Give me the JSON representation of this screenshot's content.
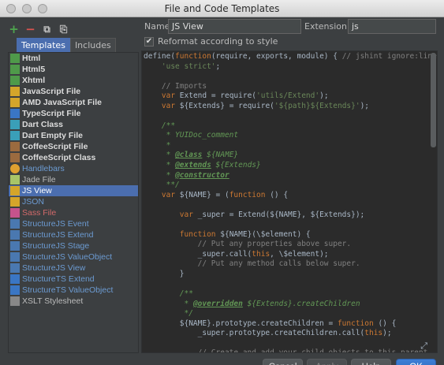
{
  "window": {
    "title": "File and Code Templates"
  },
  "toolbar": {
    "add": "+",
    "remove": "−",
    "copy": "⧉",
    "reset": "⎘"
  },
  "tabs": [
    {
      "label": "Templates",
      "active": true
    },
    {
      "label": "Includes",
      "active": false
    }
  ],
  "templates": [
    {
      "label": "Html",
      "icon": "html-file-icon",
      "style": "bold",
      "color": "c-html"
    },
    {
      "label": "Html5",
      "icon": "html-file-icon",
      "style": "bold",
      "color": "c-html"
    },
    {
      "label": "Xhtml",
      "icon": "html-file-icon",
      "style": "bold",
      "color": "c-html"
    },
    {
      "label": "JavaScript File",
      "icon": "javascript-file-icon",
      "style": "bold",
      "color": "c-js"
    },
    {
      "label": "AMD JavaScript File",
      "icon": "javascript-file-icon",
      "style": "bold",
      "color": "c-js"
    },
    {
      "label": "TypeScript File",
      "icon": "typescript-file-icon",
      "style": "bold",
      "color": "c-ts"
    },
    {
      "label": "Dart Class",
      "icon": "dart-file-icon",
      "style": "bold",
      "color": "c-dart"
    },
    {
      "label": "Dart Empty File",
      "icon": "dart-file-icon",
      "style": "bold",
      "color": "c-dart"
    },
    {
      "label": "CoffeeScript File",
      "icon": "coffeescript-file-icon",
      "style": "bold",
      "color": "c-coffee"
    },
    {
      "label": "CoffeeScript Class",
      "icon": "coffeescript-file-icon",
      "style": "bold",
      "color": "c-coffee"
    },
    {
      "label": "Handlebars",
      "icon": "handlebars-file-icon",
      "style": "blue",
      "color": "c-hbs"
    },
    {
      "label": "Jade File",
      "icon": "jade-file-icon",
      "style": "plain",
      "color": "c-jade"
    },
    {
      "label": "JS View",
      "icon": "javascript-file-icon",
      "style": "blue",
      "color": "c-js",
      "selected": true
    },
    {
      "label": "JSON",
      "icon": "json-file-icon",
      "style": "blue",
      "color": "c-js"
    },
    {
      "label": "Sass File",
      "icon": "sass-file-icon",
      "style": "red",
      "color": "c-sass"
    },
    {
      "label": "StructureJS Event",
      "icon": "javascript-file-icon",
      "style": "blue",
      "color": "c-sjs"
    },
    {
      "label": "StructureJS Extend",
      "icon": "javascript-file-icon",
      "style": "blue",
      "color": "c-sjs"
    },
    {
      "label": "StructureJS Stage",
      "icon": "javascript-file-icon",
      "style": "blue",
      "color": "c-sjs"
    },
    {
      "label": "StructureJS ValueObject",
      "icon": "javascript-file-icon",
      "style": "blue",
      "color": "c-sjs"
    },
    {
      "label": "StructureJS View",
      "icon": "javascript-file-icon",
      "style": "blue",
      "color": "c-sjs"
    },
    {
      "label": "StructureTS Extend",
      "icon": "typescript-file-icon",
      "style": "blue",
      "color": "c-ts"
    },
    {
      "label": "StructureTS ValueObject",
      "icon": "typescript-file-icon",
      "style": "blue",
      "color": "c-ts"
    },
    {
      "label": "XSLT Stylesheet",
      "icon": "xslt-file-icon",
      "style": "plain",
      "color": "c-xslt"
    }
  ],
  "form": {
    "name_label": "Name:",
    "name_value": "JS View",
    "extension_label": "Extension:",
    "extension_value": "js",
    "reformat_label": "Reformat according to style",
    "reformat_checked": true
  },
  "code_lines": [
    [
      [
        "",
        "define("
      ],
      [
        "kw",
        "function"
      ],
      [
        "",
        "(require, exports, module) { "
      ],
      [
        "cmt",
        "// jshint ignore:line"
      ]
    ],
    [
      [
        "",
        "    "
      ],
      [
        "str",
        "'use strict'"
      ],
      [
        "",
        ";"
      ]
    ],
    [
      [
        "",
        ""
      ]
    ],
    [
      [
        "",
        "    "
      ],
      [
        "cmt",
        "// Imports"
      ]
    ],
    [
      [
        "",
        "    "
      ],
      [
        "kw",
        "var"
      ],
      [
        "",
        " Extend = require("
      ],
      [
        "str",
        "'utils/Extend'"
      ],
      [
        "",
        ");"
      ]
    ],
    [
      [
        "",
        "    "
      ],
      [
        "kw",
        "var"
      ],
      [
        "",
        " ${Extends} = require("
      ],
      [
        "str",
        "'${path}${Extends}'"
      ],
      [
        "",
        ");"
      ]
    ],
    [
      [
        "",
        ""
      ]
    ],
    [
      [
        "",
        "    "
      ],
      [
        "doc",
        "/**"
      ]
    ],
    [
      [
        "",
        "     "
      ],
      [
        "doc",
        "* YUIDoc_comment"
      ]
    ],
    [
      [
        "",
        "     "
      ],
      [
        "doc",
        "*"
      ]
    ],
    [
      [
        "",
        "     "
      ],
      [
        "doc",
        "* "
      ],
      [
        "tag",
        "@class"
      ],
      [
        "doc",
        " ${NAME}"
      ]
    ],
    [
      [
        "",
        "     "
      ],
      [
        "doc",
        "* "
      ],
      [
        "tag",
        "@extends"
      ],
      [
        "doc",
        " ${Extends}"
      ]
    ],
    [
      [
        "",
        "     "
      ],
      [
        "doc",
        "* "
      ],
      [
        "tag",
        "@constructor"
      ]
    ],
    [
      [
        "",
        "     "
      ],
      [
        "doc",
        "**/"
      ]
    ],
    [
      [
        "",
        "    "
      ],
      [
        "kw",
        "var"
      ],
      [
        "",
        " ${NAME} = ("
      ],
      [
        "kw",
        "function"
      ],
      [
        "",
        " () {"
      ]
    ],
    [
      [
        "",
        ""
      ]
    ],
    [
      [
        "",
        "        "
      ],
      [
        "kw",
        "var"
      ],
      [
        "",
        " _super = Extend(${NAME}, ${Extends});"
      ]
    ],
    [
      [
        "",
        ""
      ]
    ],
    [
      [
        "",
        "        "
      ],
      [
        "kw",
        "function"
      ],
      [
        "",
        " ${NAME}(\\$element) {"
      ]
    ],
    [
      [
        "",
        "            "
      ],
      [
        "cmt",
        "// Put any properties above super."
      ]
    ],
    [
      [
        "",
        "            _super.call("
      ],
      [
        "kw",
        "this"
      ],
      [
        "",
        ", \\$element);"
      ]
    ],
    [
      [
        "",
        "            "
      ],
      [
        "cmt",
        "// Put any method calls below super."
      ]
    ],
    [
      [
        "",
        "        }"
      ]
    ],
    [
      [
        "",
        ""
      ]
    ],
    [
      [
        "",
        "        "
      ],
      [
        "doc",
        "/**"
      ]
    ],
    [
      [
        "",
        "         "
      ],
      [
        "doc",
        "* "
      ],
      [
        "tag",
        "@overridden"
      ],
      [
        "doc",
        " ${Extends}.createChildren"
      ]
    ],
    [
      [
        "",
        "         "
      ],
      [
        "doc",
        "*/"
      ]
    ],
    [
      [
        "",
        "        ${NAME}.prototype.createChildren = "
      ],
      [
        "kw",
        "function"
      ],
      [
        "",
        " () {"
      ]
    ],
    [
      [
        "",
        "            _super.prototype.createChildren.call("
      ],
      [
        "kw",
        "this"
      ],
      [
        "",
        ");"
      ]
    ],
    [
      [
        "",
        ""
      ]
    ],
    [
      [
        "",
        "            "
      ],
      [
        "cmt",
        "// Create and add your child objects to this parent"
      ]
    ]
  ],
  "buttons": {
    "cancel": "Cancel",
    "apply": "Apply",
    "help": "Help",
    "ok": "OK"
  }
}
